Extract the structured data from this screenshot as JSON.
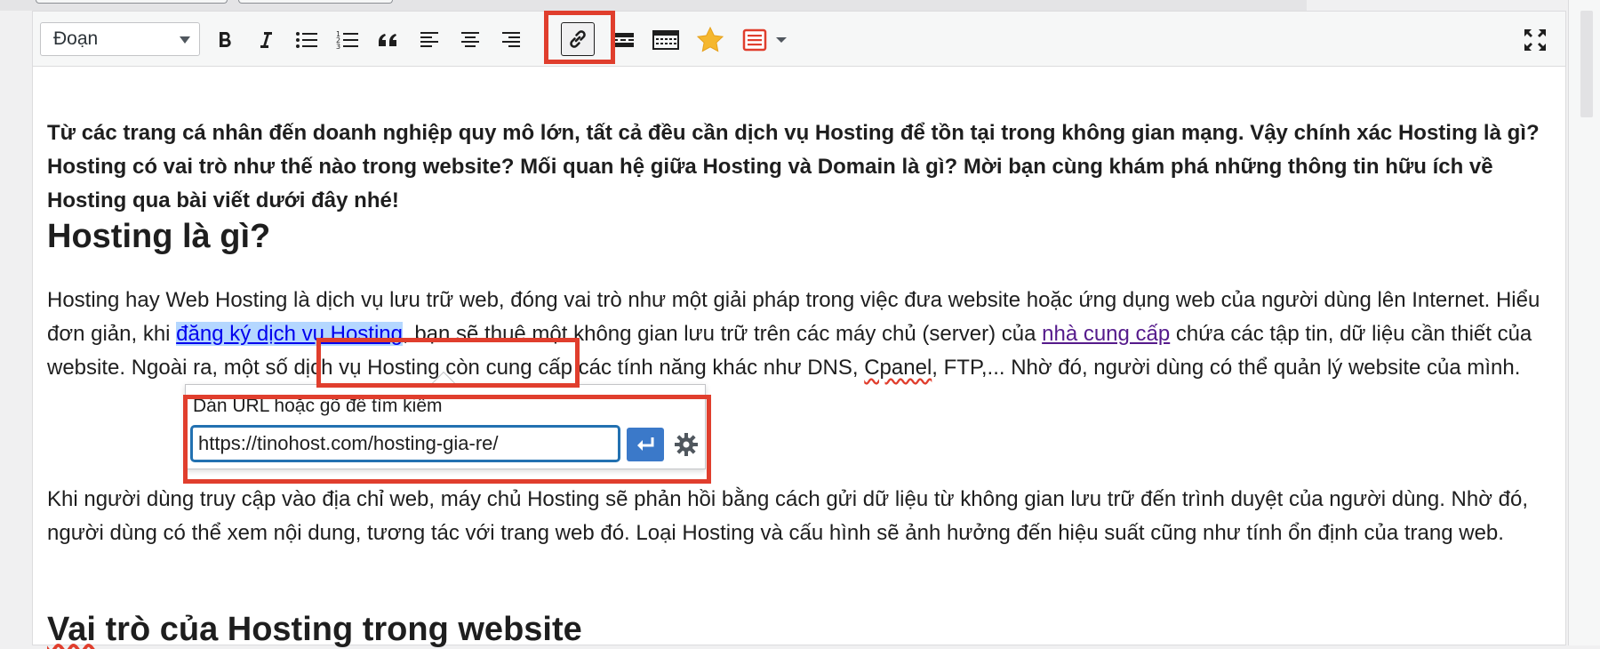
{
  "toolbar": {
    "format_value": "Đoạn",
    "buttons": [
      {
        "icon": "bold-icon"
      },
      {
        "icon": "italic-icon"
      },
      {
        "icon": "bullet-list-icon"
      },
      {
        "icon": "numbered-list-icon"
      },
      {
        "icon": "blockquote-icon"
      },
      {
        "icon": "align-left-icon"
      },
      {
        "icon": "align-center-icon"
      },
      {
        "icon": "align-right-icon"
      },
      {
        "icon": "link-icon",
        "active": true
      },
      {
        "icon": "read-more-icon"
      },
      {
        "icon": "toolbar-toggle-icon"
      },
      {
        "icon": "star-icon"
      },
      {
        "icon": "shortcode-icon"
      },
      {
        "icon": "dropdown-caret-icon"
      }
    ]
  },
  "article": {
    "intro": "Từ các trang cá nhân đến doanh nghiệp quy mô lớn, tất cả đều cần dịch vụ Hosting để tồn tại trong không gian mạng. Vậy chính xác Hosting là gì? Hosting có vai trò như thế nào trong website? Mối quan hệ giữa Hosting và Domain là gì? Mời bạn cùng khám phá những thông tin hữu ích về Hosting qua bài viết dưới đây nhé!",
    "heading1": "Hosting là gì?",
    "p1_a": "Hosting hay Web Hosting là dịch vụ lưu trữ web, đóng vai trò như một giải pháp trong việc đưa website hoặc ứng dụng web của người dùng lên Internet. Hiểu đơn giản, khi ",
    "p1_link1": "đăng ký dịch vụ Hosting",
    "p1_b": ", bạn sẽ thuê một không gian lưu trữ trên các máy chủ (server) của ",
    "p1_link2": "nhà cung cấp",
    "p1_c": " chứa các tập tin, dữ liệu cần thiết của website. Ngoài ra, một số dịch vụ Hosting còn cung cấp các tính năng khác như DNS, ",
    "p1_cpanel": "Cpanel",
    "p1_d": ", FTP,... Nhờ đó, người dùng có thể quản lý website của mình.",
    "p2": "Khi người dùng truy cập vào địa chỉ web, máy chủ Hosting sẽ phản hồi bằng cách gửi dữ liệu từ không gian lưu trữ đến trình duyệt của người dùng. Nhờ đó, người dùng có thể xem nội dung, tương tác với trang web đó. Loại Hosting và cấu hình sẽ ảnh hưởng đến hiệu suất cũng như tính ổn định của trang web.",
    "heading2_a": "Vai",
    "heading2_b": " trò của Hosting trong website"
  },
  "link_popup": {
    "label": "Dán URL hoặc gõ để tìm kiếm",
    "url_value": "https://tinohost.com/hosting-gia-re/",
    "apply_icon": "enter-icon",
    "settings_icon": "gear-icon"
  },
  "colors": {
    "highlight": "#e03e2d",
    "link": "#0000ee",
    "visited_link": "#551a8b",
    "selection": "#b4d7ff",
    "primary": "#3b79c9"
  }
}
